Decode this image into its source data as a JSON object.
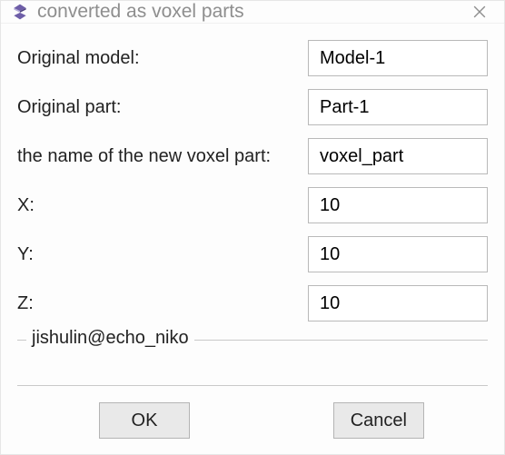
{
  "window": {
    "title": "converted as voxel parts"
  },
  "form": {
    "rows": [
      {
        "label": "Original model:",
        "value": "Model-1"
      },
      {
        "label": "Original part:",
        "value": "Part-1"
      },
      {
        "label": "the name of the new voxel part:",
        "value": "voxel_part"
      },
      {
        "label": "X:",
        "value": "10"
      },
      {
        "label": "Y:",
        "value": "10"
      },
      {
        "label": "Z:",
        "value": "10"
      }
    ]
  },
  "group": {
    "label": "jishulin@echo_niko"
  },
  "buttons": {
    "ok": "OK",
    "cancel": "Cancel"
  }
}
